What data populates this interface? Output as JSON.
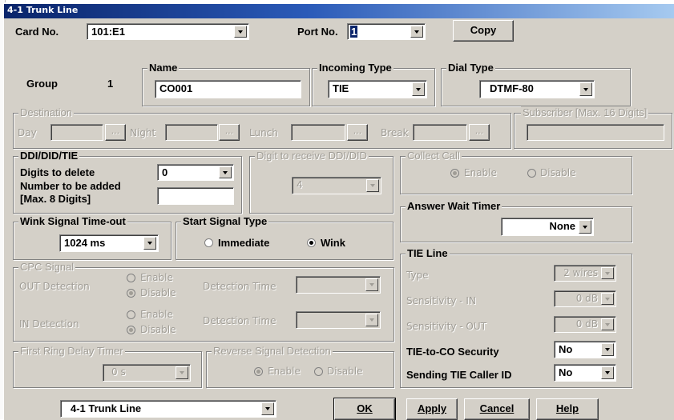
{
  "window": {
    "title": "4-1 Trunk Line"
  },
  "card": {
    "label": "Card No.",
    "value": "101:E1"
  },
  "port": {
    "label": "Port No.",
    "value": "1"
  },
  "copy_button": "Copy",
  "group": {
    "label": "Group",
    "value": "1"
  },
  "name": {
    "label": "Name",
    "value": "CO001"
  },
  "incoming_type": {
    "label": "Incoming Type",
    "value": "TIE"
  },
  "dial_type": {
    "label": "Dial Type",
    "value": "DTMF-80"
  },
  "destination": {
    "label": "Destination",
    "day": "Day",
    "night": "Night",
    "lunch": "Lunch",
    "break": "Break",
    "browse": "..."
  },
  "subscriber": {
    "label": "Subscriber [Max. 16 Digits]"
  },
  "ddi": {
    "label": "DDI/DID/TIE",
    "digits_delete_label": "Digits to delete",
    "digits_delete_value": "0",
    "number_added_label_1": "Number to be added",
    "number_added_label_2": "[Max. 8 Digits]"
  },
  "digit_receive": {
    "label": "Digit to receive DDI/DID",
    "value": "4"
  },
  "collect_call": {
    "label": "Collect Call",
    "enable": "Enable",
    "disable": "Disable"
  },
  "wink": {
    "label": "Wink Signal Time-out",
    "value": "1024 ms"
  },
  "start_signal": {
    "label": "Start Signal Type",
    "immediate": "Immediate",
    "wink": "Wink"
  },
  "answer_wait": {
    "label": "Answer Wait Timer",
    "value": "None"
  },
  "cpc": {
    "label": "CPC Signal",
    "out_label": "OUT Detection",
    "in_label": "IN Detection",
    "enable": "Enable",
    "disable": "Disable",
    "detection_time": "Detection Time"
  },
  "tie_line": {
    "label": "TIE Line",
    "type_label": "Type",
    "type_value": "2 wires",
    "sens_in_label": "Sensitivity - IN",
    "sens_in_value": "0 dB",
    "sens_out_label": "Sensitivity - OUT",
    "sens_out_value": "0 dB",
    "security_label": "TIE-to-CO Security",
    "security_value": "No",
    "caller_id_label": "Sending TIE Caller ID",
    "caller_id_value": "No"
  },
  "first_ring": {
    "label": "First Ring Delay Timer",
    "value": "0 s"
  },
  "reverse_signal": {
    "label": "Reverse Signal Detection",
    "enable": "Enable",
    "disable": "Disable"
  },
  "bottom": {
    "screen_value": "4-1 Trunk Line",
    "ok": "OK",
    "apply": "Apply",
    "cancel": "Cancel",
    "help": "Help"
  }
}
